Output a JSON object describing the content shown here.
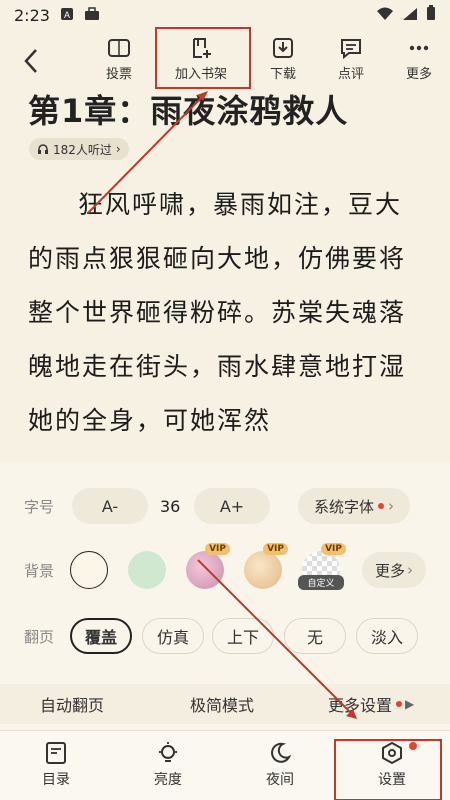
{
  "status": {
    "time": "2:23"
  },
  "toolbar": {
    "items": [
      {
        "label": "投票"
      },
      {
        "label": "加入书架"
      },
      {
        "label": "下载"
      },
      {
        "label": "点评"
      },
      {
        "label": "更多"
      }
    ]
  },
  "chapter": {
    "title": "第1章：雨夜涂鸦救人",
    "listeners": "182人听过",
    "text": "狂风呼啸，暴雨如注，豆大的雨点狠狠砸向大地，仿佛要将整个世界砸得粉碎。苏棠失魂落魄地走在街头，雨水肆意地打湿她的全身，可她浑然"
  },
  "settings": {
    "font": {
      "label": "字号",
      "decrease": "A-",
      "size": "36",
      "increase": "A+",
      "family": "系统字体"
    },
    "background": {
      "label": "背景",
      "vip": "VIP",
      "custom": "自定义",
      "more": "更多"
    },
    "page_turn": {
      "label": "翻页",
      "options": [
        "覆盖",
        "仿真",
        "上下",
        "无",
        "淡入"
      ],
      "selected": "覆盖"
    },
    "bottom": {
      "auto": "自动翻页",
      "minimal": "极简模式",
      "more": "更多设置"
    }
  },
  "nav": {
    "items": [
      {
        "label": "目录"
      },
      {
        "label": "亮度"
      },
      {
        "label": "夜间"
      },
      {
        "label": "设置"
      }
    ]
  },
  "colors": {
    "accent": "#e8432f",
    "annotation": "#c0392b",
    "paper": "#f7f1e3"
  }
}
